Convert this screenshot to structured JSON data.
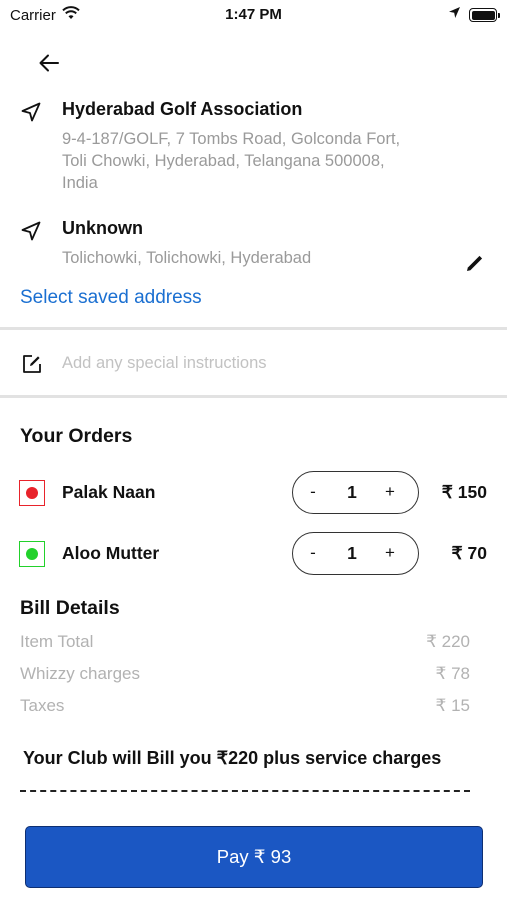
{
  "status_bar": {
    "carrier": "Carrier",
    "time": "1:47 PM",
    "icons": [
      "wifi-icon",
      "location-arrow-icon",
      "battery-icon"
    ]
  },
  "header": {
    "back_icon": "arrow-left-icon"
  },
  "addresses": [
    {
      "icon": "navigation-arrow-icon",
      "title": "Hyderabad Golf Association",
      "lines": [
        "9-4-187/GOLF, 7 Tombs Road, Golconda Fort,",
        "Toli Chowki, Hyderabad, Telangana 500008,",
        "India"
      ]
    },
    {
      "icon": "navigation-arrow-icon",
      "title": "Unknown",
      "lines": [
        "Tolichowki, Tolichowki, Hyderabad"
      ],
      "edit_icon": "pencil-icon"
    }
  ],
  "saved_address_link": "Select saved address",
  "instructions": {
    "icon": "edit-note-icon",
    "placeholder": "Add any special instructions",
    "value": ""
  },
  "orders": {
    "title": "Your Orders",
    "items": [
      {
        "name": "Palak Naan",
        "qty": "1",
        "price": "₹ 150",
        "indicator_color": "#e8232b",
        "minus": "-",
        "plus": "+"
      },
      {
        "name": "Aloo Mutter",
        "qty": "1",
        "price": "₹ 70",
        "indicator_color": "#22d12b",
        "minus": "-",
        "plus": "+"
      }
    ]
  },
  "bill": {
    "title": "Bill Details",
    "rows": [
      {
        "label": "Item Total",
        "value": "₹ 220"
      },
      {
        "label": "Whizzy charges",
        "value": "₹ 78"
      },
      {
        "label": "Taxes",
        "value": "₹ 15"
      }
    ]
  },
  "club_note": "Your Club will Bill you ₹220 plus service charges",
  "pay_button": "Pay ₹ 93",
  "colors": {
    "link": "#1a6fd1",
    "pay_button": "#1b57c3",
    "nonveg": "#e8232b",
    "veg": "#22d12b"
  }
}
